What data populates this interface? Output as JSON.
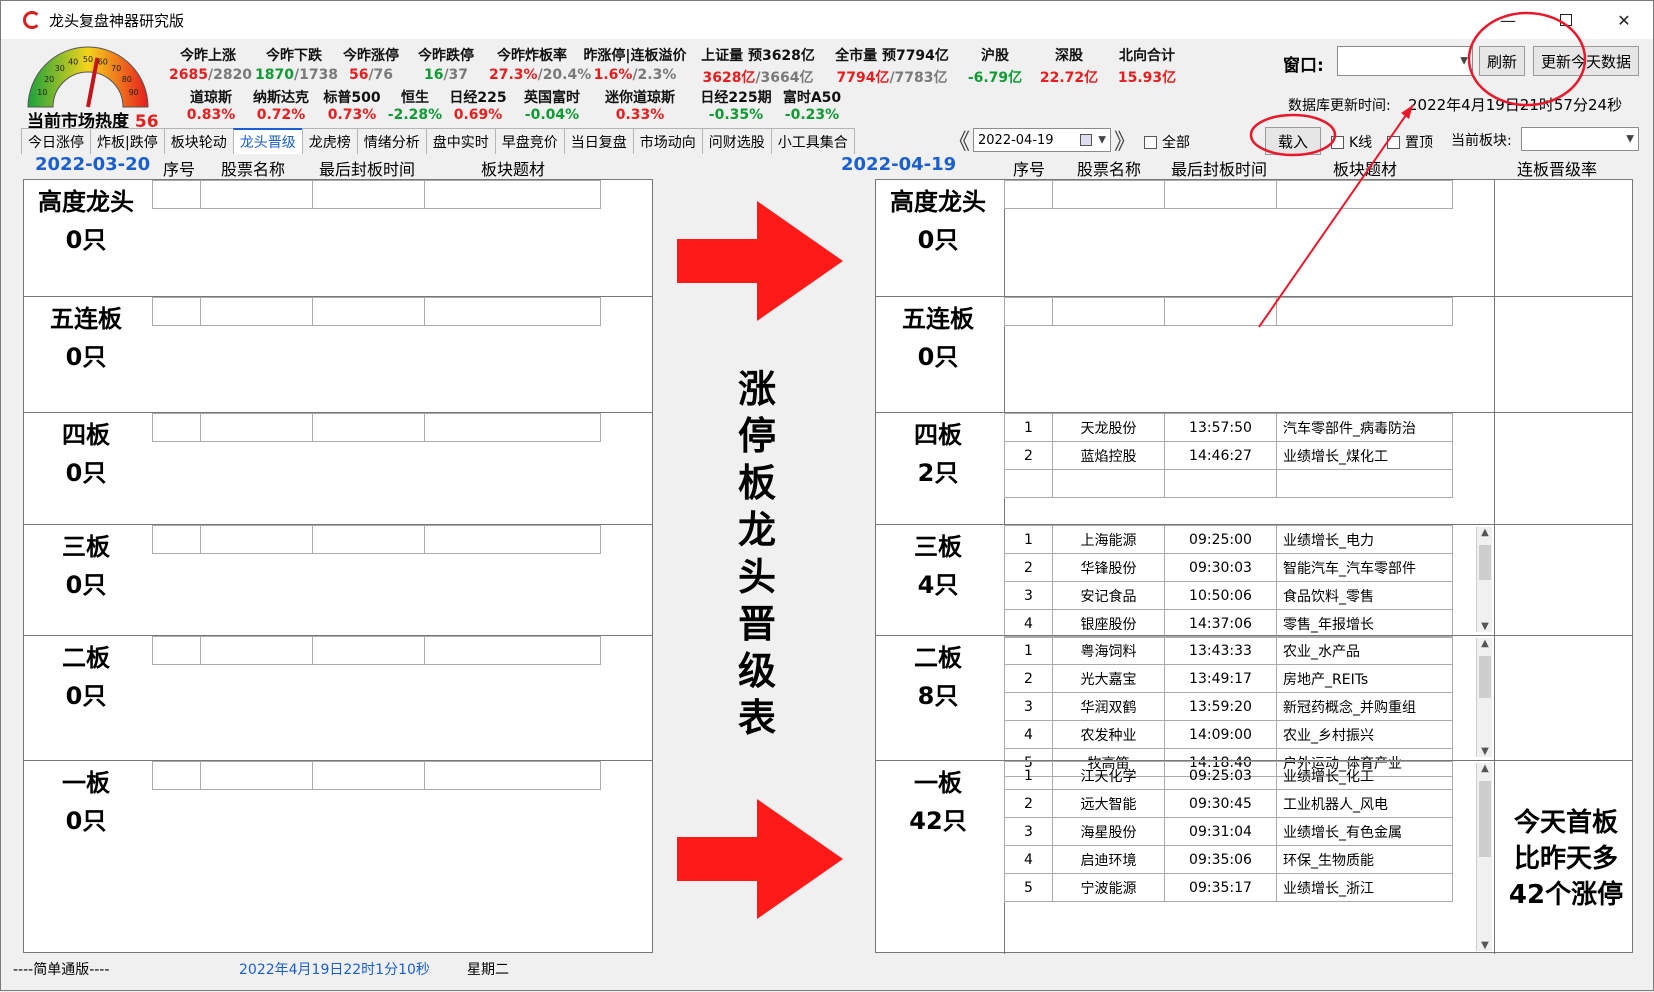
{
  "window": {
    "title": "龙头复盘神器研究版"
  },
  "gauge": {
    "ticks": [
      "10",
      "20",
      "30",
      "40",
      "50",
      "60",
      "70",
      "80",
      "90"
    ],
    "label": "当前市场热度",
    "value": "56",
    "level": 0.56
  },
  "stats_row1": [
    {
      "label": "今昨上涨",
      "v1": "2685",
      "v2": "/2820",
      "color": "red"
    },
    {
      "label": "今昨下跌",
      "v1": "1870",
      "v2": "/1738",
      "color": "green"
    },
    {
      "label": "今昨涨停",
      "v1": "56",
      "v2": "/76",
      "color": "red"
    },
    {
      "label": "今昨跌停",
      "v1": "16",
      "v2": "/37",
      "color": "green"
    },
    {
      "label": "今昨炸板率",
      "v1": "27.3%",
      "v2": "/20.4%",
      "color": "red"
    },
    {
      "label": "昨涨停|连板溢价",
      "v1": "1.6%",
      "v2": "/2.3%",
      "color": "red"
    },
    {
      "label": "上证量 预3628亿",
      "v1": "3628亿",
      "v2": "/3664亿",
      "color": "red"
    },
    {
      "label": "全市量 预7794亿",
      "v1": "7794亿",
      "v2": "/7783亿",
      "color": "red"
    },
    {
      "label": "沪股",
      "v1": "-6.79亿",
      "v2": "",
      "color": "green"
    },
    {
      "label": "深股",
      "v1": "22.72亿",
      "v2": "",
      "color": "red"
    },
    {
      "label": "北向合计",
      "v1": "15.93亿",
      "v2": "",
      "color": "red"
    }
  ],
  "stats_row2": [
    {
      "label": "道琼斯",
      "v": "0.83%",
      "color": "red"
    },
    {
      "label": "纳斯达克",
      "v": "0.72%",
      "color": "red"
    },
    {
      "label": "标普500",
      "v": "0.73%",
      "color": "red"
    },
    {
      "label": "恒生",
      "v": "-2.28%",
      "color": "green"
    },
    {
      "label": "日经225",
      "v": "0.69%",
      "color": "red"
    },
    {
      "label": "英国富时",
      "v": "-0.04%",
      "color": "green"
    },
    {
      "label": "迷你道琼斯",
      "v": "0.33%",
      "color": "red"
    },
    {
      "label": "日经225期",
      "v": "-0.35%",
      "color": "green"
    },
    {
      "label": "富时A50",
      "v": "-0.23%",
      "color": "green"
    }
  ],
  "controls": {
    "window_label": "窗口:",
    "refresh_label": "刷新",
    "update_today_label": "更新今天数据",
    "db_update_label": "数据库更新时间:",
    "db_update_time": "2022年4月19日21时57分24秒",
    "date_value": "2022-04-19",
    "load_label": "载入",
    "kline_label": "K线",
    "top_label": "置顶",
    "all_label": "全部",
    "current_sector_label": "当前板块:"
  },
  "tabs": [
    "今日涨停",
    "炸板|跌停",
    "板块轮动",
    "龙头晋级",
    "龙虎榜",
    "情绪分析",
    "盘中实时",
    "早盘竞价",
    "当日复盘",
    "市场动向",
    "问财选股",
    "小工具集合"
  ],
  "active_tab": 3,
  "headers": {
    "left_date": "2022-03-20",
    "right_date": "2022-04-19",
    "seq": "序号",
    "name": "股票名称",
    "time": "最后封板时间",
    "topic": "板块题材",
    "rate": "连板晋级率"
  },
  "left_sections": [
    {
      "title": "高度龙头",
      "count": "0只"
    },
    {
      "title": "五连板",
      "count": "0只"
    },
    {
      "title": "四板",
      "count": "0只"
    },
    {
      "title": "三板",
      "count": "0只"
    },
    {
      "title": "二板",
      "count": "0只"
    },
    {
      "title": "一板",
      "count": "0只"
    }
  ],
  "right_sections": [
    {
      "title": "高度龙头",
      "count": "0只",
      "rows": []
    },
    {
      "title": "五连板",
      "count": "0只",
      "rows": []
    },
    {
      "title": "四板",
      "count": "2只",
      "rows": [
        [
          "1",
          "天龙股份",
          "13:57:50",
          "汽车零部件_病毒防治"
        ],
        [
          "2",
          "蓝焰控股",
          "14:46:27",
          "业绩增长_煤化工"
        ]
      ]
    },
    {
      "title": "三板",
      "count": "4只",
      "rows": [
        [
          "1",
          "上海能源",
          "09:25:00",
          "业绩增长_电力"
        ],
        [
          "2",
          "华锋股份",
          "09:30:03",
          "智能汽车_汽车零部件"
        ],
        [
          "3",
          "安记食品",
          "10:50:06",
          "食品饮料_零售"
        ],
        [
          "4",
          "银座股份",
          "14:37:06",
          "零售_年报增长"
        ]
      ]
    },
    {
      "title": "二板",
      "count": "8只",
      "rows": [
        [
          "1",
          "粤海饲料",
          "13:43:33",
          "农业_水产品"
        ],
        [
          "2",
          "光大嘉宝",
          "13:49:17",
          "房地产_REITs"
        ],
        [
          "3",
          "华润双鹤",
          "13:59:20",
          "新冠药概念_并购重组"
        ],
        [
          "4",
          "农发种业",
          "14:09:00",
          "农业_乡村振兴"
        ],
        [
          "5",
          "牧高笛",
          "14:18:40",
          "户外运动_体育产业"
        ]
      ]
    },
    {
      "title": "一板",
      "count": "42只",
      "rows": [
        [
          "1",
          "江天化学",
          "09:25:03",
          "业绩增长_化工"
        ],
        [
          "2",
          "远大智能",
          "09:30:45",
          "工业机器人_风电"
        ],
        [
          "3",
          "海星股份",
          "09:31:04",
          "业绩增长_有色金属"
        ],
        [
          "4",
          "启迪环境",
          "09:35:06",
          "环保_生物质能"
        ],
        [
          "5",
          "宁波能源",
          "09:35:17",
          "业绩增长_浙江"
        ]
      ]
    }
  ],
  "center_title": [
    "涨",
    "停",
    "板",
    "龙",
    "头",
    "晋",
    "级",
    "表"
  ],
  "right_note": [
    "今天首板",
    "比昨天多",
    "42个涨停"
  ],
  "status": {
    "edition": "----简单通版----",
    "datetime": "2022年4月19日22时1分10秒",
    "weekday": "星期二"
  },
  "colors": {
    "red": "#e81d1d",
    "green": "#0f9a33",
    "blue": "#1a5fd0",
    "arrow": "#ff1a1a",
    "annotation": "#e8182a"
  }
}
